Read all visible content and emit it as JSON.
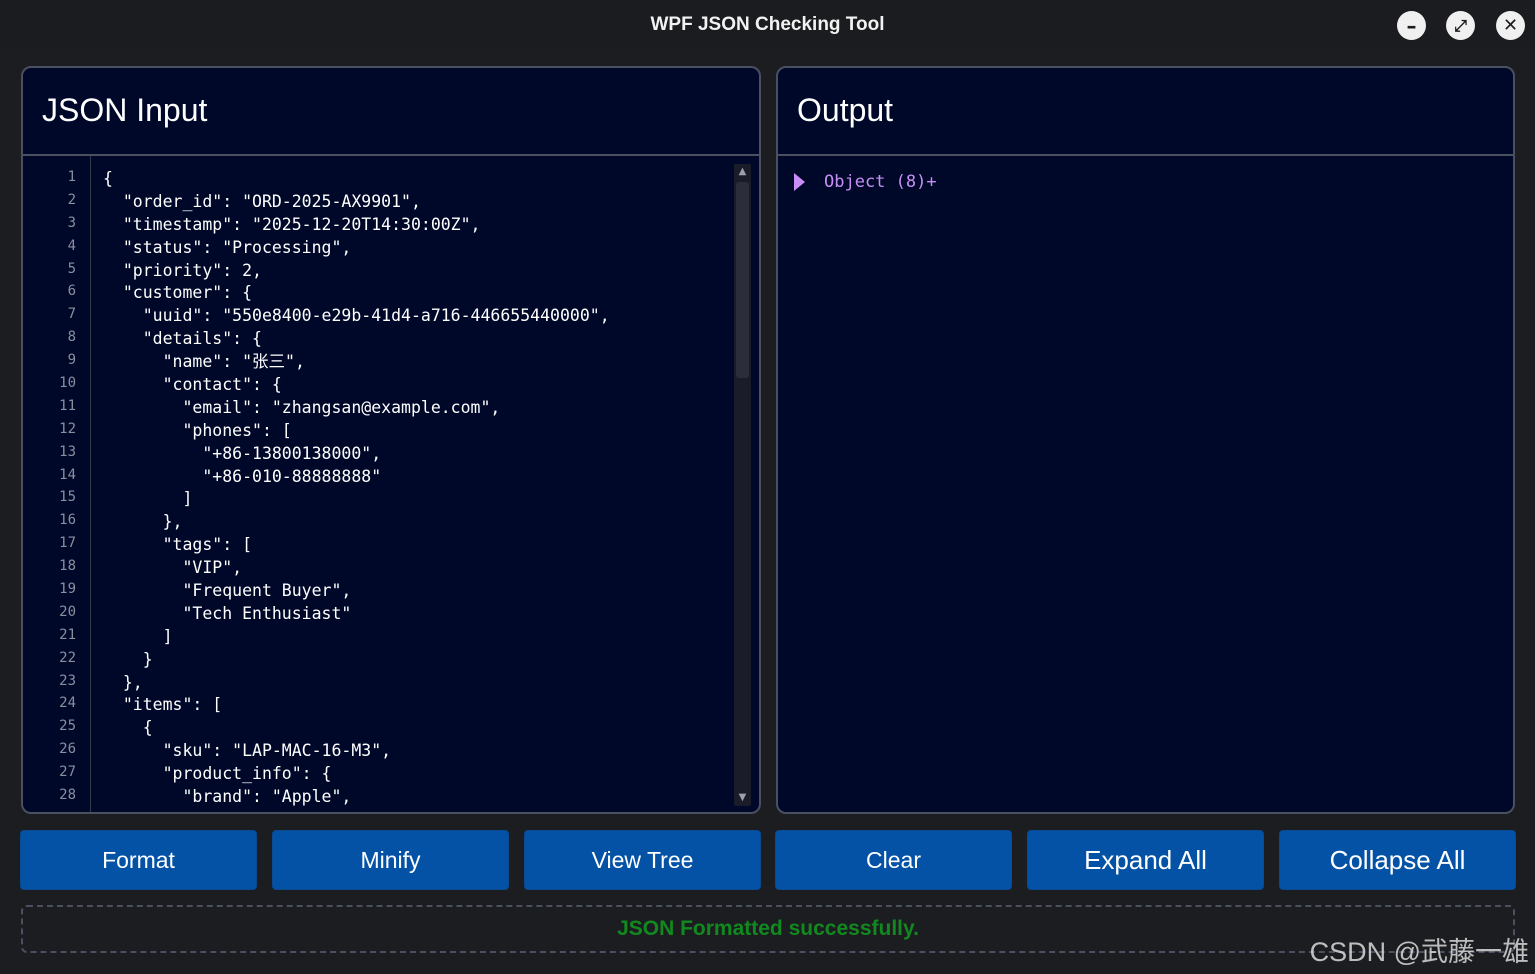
{
  "window": {
    "title": "WPF JSON Checking Tool"
  },
  "input_panel": {
    "title": "JSON Input",
    "line_numbers": [
      "1",
      "2",
      "3",
      "4",
      "5",
      "6",
      "7",
      "8",
      "9",
      "10",
      "11",
      "12",
      "13",
      "14",
      "15",
      "16",
      "17",
      "18",
      "19",
      "20",
      "21",
      "22",
      "23",
      "24",
      "25",
      "26",
      "27",
      "28"
    ],
    "lines": [
      "{",
      "  \"order_id\": \"ORD-2025-AX9901\",",
      "  \"timestamp\": \"2025-12-20T14:30:00Z\",",
      "  \"status\": \"Processing\",",
      "  \"priority\": 2,",
      "  \"customer\": {",
      "    \"uuid\": \"550e8400-e29b-41d4-a716-446655440000\",",
      "    \"details\": {",
      "      \"name\": \"张三\",",
      "      \"contact\": {",
      "        \"email\": \"zhangsan@example.com\",",
      "        \"phones\": [",
      "          \"+86-13800138000\",",
      "          \"+86-010-88888888\"",
      "        ]",
      "      },",
      "      \"tags\": [",
      "        \"VIP\",",
      "        \"Frequent Buyer\",",
      "        \"Tech Enthusiast\"",
      "      ]",
      "    }",
      "  },",
      "  \"items\": [",
      "    {",
      "      \"sku\": \"LAP-MAC-16-M3\",",
      "      \"product_info\": {",
      "        \"brand\": \"Apple\","
    ]
  },
  "output_panel": {
    "title": "Output",
    "tree_root_label": "Object (8)+"
  },
  "buttons": {
    "format": "Format",
    "minify": "Minify",
    "view_tree": "View Tree",
    "clear": "Clear",
    "expand_all": "Expand All",
    "collapse_all": "Collapse All"
  },
  "status": {
    "message": "JSON Formatted successfully."
  },
  "watermark": "CSDN @武藤一雄",
  "colors": {
    "panel_bg": "#00082a",
    "button_bg": "#0352a6",
    "status_text": "#11891f",
    "tree_text": "#c98ef5"
  }
}
